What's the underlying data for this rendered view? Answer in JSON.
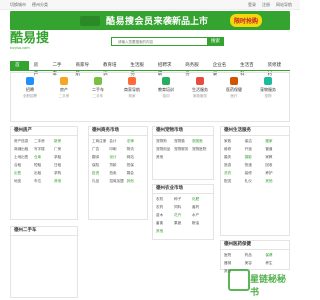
{
  "topbar": {
    "left": [
      "切换城市",
      "德州分类"
    ],
    "right": [
      "登录",
      "注册",
      "网站导航"
    ]
  },
  "banner": {
    "text1": "酷易搜会员来袭",
    "text2": "新品上市",
    "cta": "限时抢购"
  },
  "logo": {
    "title": "酷易搜",
    "sub": "kuyiso.com"
  },
  "search": {
    "placeholder": "请输入您要搜索的内容",
    "button": "搜索"
  },
  "nav": [
    "首页",
    "房产",
    "二手车",
    "商家导航",
    "教育培训",
    "生活服务",
    "招聘求职",
    "商务服务",
    "企业名录",
    "生活百科",
    "装修建材"
  ],
  "cats": [
    {
      "name": "招聘",
      "sub": "全职招聘",
      "color": "#1e90ff"
    },
    {
      "name": "房产",
      "sub": "二手房",
      "color": "#f5a623"
    },
    {
      "name": "二手车",
      "sub": "二手车",
      "color": "#7ac142"
    },
    {
      "name": "商家导航",
      "sub": "商家",
      "color": "#ff6b35"
    },
    {
      "name": "教育培训",
      "sub": "培训",
      "color": "#27ae60"
    },
    {
      "name": "生活服务",
      "sub": "家政服务",
      "color": "#e74c3c"
    },
    {
      "name": "医药保健",
      "sub": "医疗",
      "color": "#d35400"
    },
    {
      "name": "宠物服务",
      "sub": "宠物",
      "color": "#1abc9c"
    }
  ],
  "panels": [
    {
      "title": "德州房产",
      "items": [
        "房产信息",
        "二手房",
        "新房",
        "商铺出租",
        "写字楼",
        "厂房",
        "土地出售",
        "仓库",
        "求租",
        "合租",
        "短租",
        "日租",
        "出售",
        "出租",
        "求购",
        "地皮",
        "车位",
        "其他"
      ]
    },
    {
      "title": "德州商务市场",
      "items": [
        "工商注册",
        "会计",
        "法律",
        "广告",
        "印刷",
        "物流",
        "翻译",
        "设计",
        "网站",
        "保险",
        "贷款",
        "担保",
        "投资",
        "拍卖",
        "展会",
        "礼品",
        "招商加盟",
        "其他"
      ]
    },
    {
      "title": "德州宠物市场",
      "items": [
        "宠物狗",
        "宠物猫",
        "观赏鱼",
        "宠物用品",
        "宠物服务",
        "宠物医院",
        "其他"
      ]
    },
    {
      "title": "德州生活服务",
      "items": [
        "家政",
        "保洁",
        "搬家",
        "维修",
        "开锁",
        "管道",
        "婚庆",
        "摄影",
        "家教",
        "旅游",
        "快递",
        "回收",
        "洗衣",
        "装修",
        "养护",
        "配送",
        "礼仪",
        "其他"
      ]
    },
    {
      "title": "德州农业市场",
      "items": [
        "农机",
        "种子",
        "化肥",
        "农药",
        "饲料",
        "兽药",
        "苗木",
        "花卉",
        "水产",
        "畜禽",
        "果蔬",
        "粮油",
        "其他"
      ]
    },
    {
      "title": "德州医药保健",
      "items": [
        "医院",
        "药品",
        "保健",
        "器械",
        "美容",
        "养生",
        "其他"
      ]
    },
    {
      "title": "德州二手车",
      "items": []
    }
  ],
  "watermark": "星链秘秘书"
}
